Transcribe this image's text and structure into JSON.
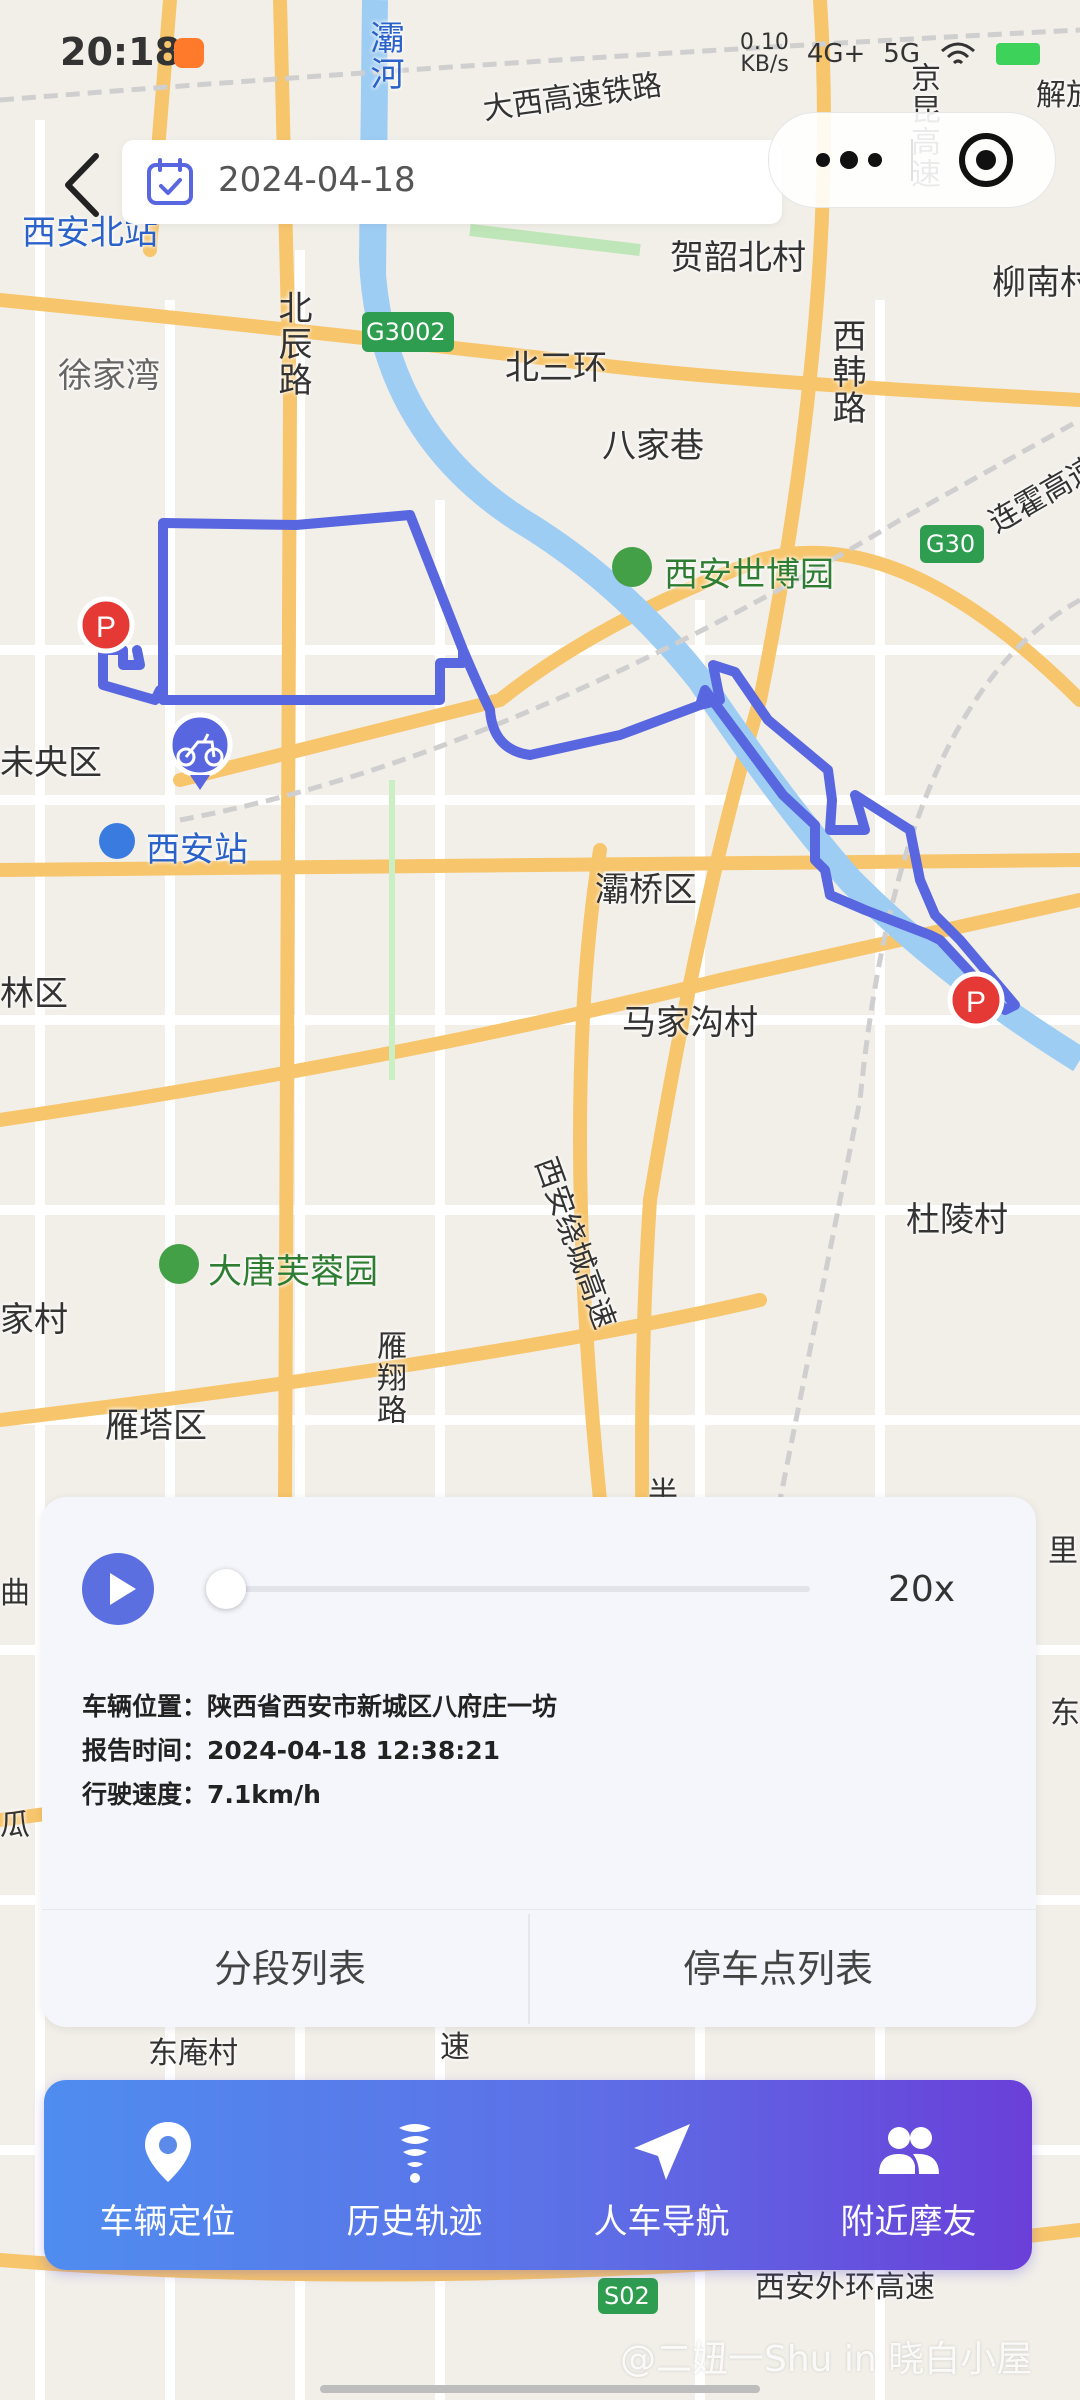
{
  "status_bar": {
    "time": "20:18",
    "net_speed": "0.10",
    "net_unit": "KB/s",
    "signal_1": "4G+",
    "signal_2": "5G"
  },
  "header": {
    "back_icon": "chevron-left-icon",
    "date_icon": "calendar-check-icon",
    "date_value": "2024-04-18",
    "more_icon": "more-dots-icon",
    "target_icon": "target-icon"
  },
  "map": {
    "labels": [
      "大西高速铁路",
      "灞河",
      "西安北站",
      "贺韶北村",
      "京昆高速",
      "解放",
      "柳南村",
      "北辰路",
      "G3002",
      "北三环",
      "徐家湾",
      "西韩路",
      "八家巷",
      "连霍高速",
      "G30",
      "西安世博园",
      "未央区",
      "西安站",
      "灞桥区",
      "林区",
      "马家沟村",
      "西安绕城高速",
      "杜陵村",
      "大唐芙蓉园",
      "家村",
      "雁翔路",
      "雁塔区",
      "东庵村",
      "S02",
      "西安外环高速",
      "里",
      "东",
      "瓜",
      "曲",
      "速",
      "半"
    ],
    "route_color": "#5866e0",
    "parking_marker_label": "P",
    "vehicle_icon": "motorcycle-icon"
  },
  "playback": {
    "play_icon": "play-icon",
    "speed_multiplier": "20x",
    "progress": 0,
    "location_label": "车辆位置：",
    "location_value": "陕西省西安市新城区八府庄一坊",
    "report_time_label": "报告时间：",
    "report_time_value": "2024-04-18 12:38:21",
    "speed_label": "行驶速度：",
    "speed_value": "7.1km/h",
    "tab_segments": "分段列表",
    "tab_parking": "停车点列表"
  },
  "bottom_nav": {
    "items": [
      {
        "label": "车辆定位",
        "icon": "location-pin-icon"
      },
      {
        "label": "历史轨迹",
        "icon": "history-track-icon"
      },
      {
        "label": "人车导航",
        "icon": "navigation-arrow-icon"
      },
      {
        "label": "附近摩友",
        "icon": "friends-icon"
      }
    ],
    "gradient_start": "#4f8df0",
    "gradient_end": "#6a3fd9"
  },
  "watermark": "@二妞一Shu in 晓白小屋"
}
